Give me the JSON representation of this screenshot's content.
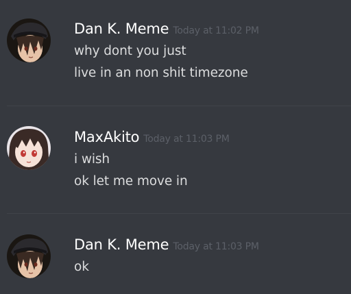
{
  "messages": [
    {
      "author": "Dan K. Meme",
      "timestamp": "Today at 11:02 PM",
      "avatar_icon": "dan-avatar",
      "lines": [
        "why dont you just",
        "live in an non shit timezone"
      ]
    },
    {
      "author": "MaxAkito",
      "timestamp": "Today at 11:03 PM",
      "avatar_icon": "maxakito-avatar",
      "lines": [
        "i wish",
        "ok let me move in"
      ]
    },
    {
      "author": "Dan K. Meme",
      "timestamp": "Today at 11:03 PM",
      "avatar_icon": "dan-avatar",
      "lines": [
        "ok"
      ]
    }
  ],
  "colors": {
    "background": "#36393f",
    "username": "#ffffff",
    "timestamp": "#5c6068",
    "message_text": "#dcddde",
    "divider": "#40434a"
  }
}
